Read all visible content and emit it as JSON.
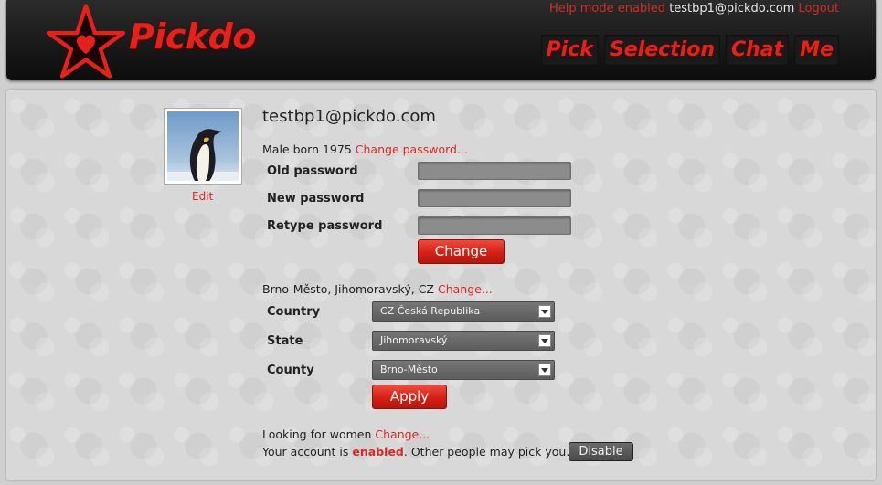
{
  "header": {
    "brand": "Pickdo",
    "help_mode": "Help mode enabled",
    "user_email": "testbp1@pickdo.com",
    "logout": "Logout",
    "nav": [
      "Pick",
      "Selection",
      "Chat",
      "Me"
    ]
  },
  "profile": {
    "email": "testbp1@pickdo.com",
    "edit": "Edit",
    "info": "Male born 1975",
    "change_password_link": "Change password...",
    "old_password_label": "Old password",
    "new_password_label": "New password",
    "retype_password_label": "Retype password",
    "change_button": "Change",
    "location": "Brno-Město, Jihomoravský, CZ",
    "change_location_link": "Change...",
    "country_label": "Country",
    "country_value": "CZ Česká Republika",
    "state_label": "State",
    "state_value": "Jihomoravský",
    "county_label": "County",
    "county_value": "Brno-Město",
    "apply_button": "Apply",
    "looking_for": "Looking for women",
    "change_looking_link": "Change...",
    "account_prefix": "Your account is",
    "account_status": "enabled",
    "account_suffix": ". Other people may pick you.",
    "disable_button": "Disable"
  },
  "colors": {
    "accent": "#d62b23",
    "header_bg": "#151515"
  },
  "icons": {
    "logo": "star-heart-logo-icon",
    "dropdown": "chevron-down-icon"
  }
}
